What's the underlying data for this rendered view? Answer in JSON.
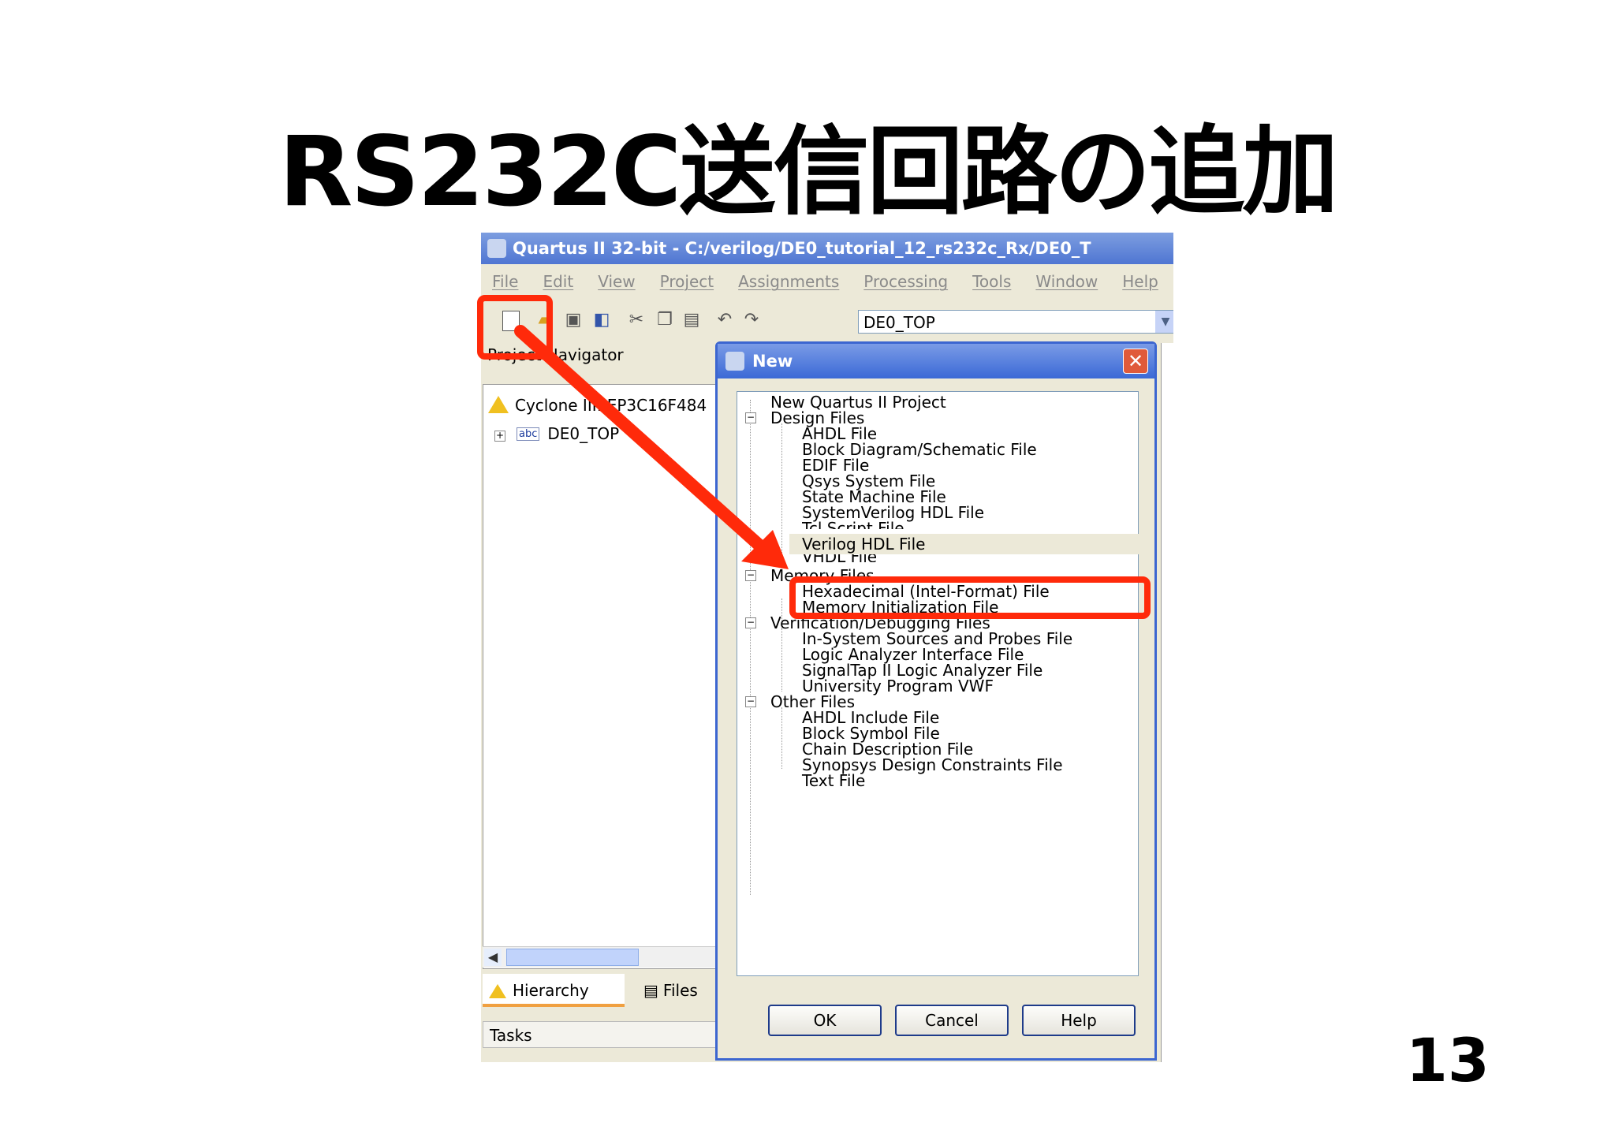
{
  "slide": {
    "title": "RS232C送信回路の追加",
    "page_number": "13"
  },
  "window": {
    "title": "Quartus II 32-bit - C:/verilog/DE0_tutorial_12_rs232c_Rx/DE0_T",
    "menu": [
      "File",
      "Edit",
      "View",
      "Project",
      "Assignments",
      "Processing",
      "Tools",
      "Window",
      "Help"
    ],
    "top_entity_combo": "DE0_TOP"
  },
  "project_navigator": {
    "header": "Project Navigator",
    "device": "Cyclone III: EP3C16F484",
    "entity": "DE0_TOP",
    "tabs": [
      "Hierarchy",
      "Files"
    ],
    "tasks_label": "Tasks"
  },
  "new_dialog": {
    "title": "New",
    "items": {
      "new_project": "New Quartus II Project",
      "design_files": "Design Files",
      "ahdl_file": "AHDL File",
      "block_diagram": "Block Diagram/Schematic File",
      "edif_file": "EDIF File",
      "qsys_file": "Qsys System File",
      "state_machine": "State Machine File",
      "systemverilog": "SystemVerilog HDL File",
      "tcl_script": "Tcl Script File",
      "verilog": "Verilog HDL File",
      "vhdl": "VHDL File",
      "memory_files": "Memory Files",
      "hex_file": "Hexadecimal (Intel-Format) File",
      "mif_file": "Memory Initialization File",
      "verification_files": "Verification/Debugging Files",
      "in_system_sources": "In-System Sources and Probes File",
      "logic_analyzer_interface": "Logic Analyzer Interface File",
      "signaltap": "SignalTap II Logic Analyzer File",
      "university_vwf": "University Program VWF",
      "other_files": "Other Files",
      "ahdl_include": "AHDL Include File",
      "block_symbol": "Block Symbol File",
      "chain_description": "Chain Description File",
      "synopsys_constraints": "Synopsys Design Constraints File",
      "text_file": "Text File"
    },
    "buttons": {
      "ok": "OK",
      "cancel": "Cancel",
      "help": "Help"
    }
  },
  "colors": {
    "highlight_red": "#ff2a0a",
    "xp_blue": "#3b69d6",
    "dialog_bg": "#ece9d8"
  }
}
